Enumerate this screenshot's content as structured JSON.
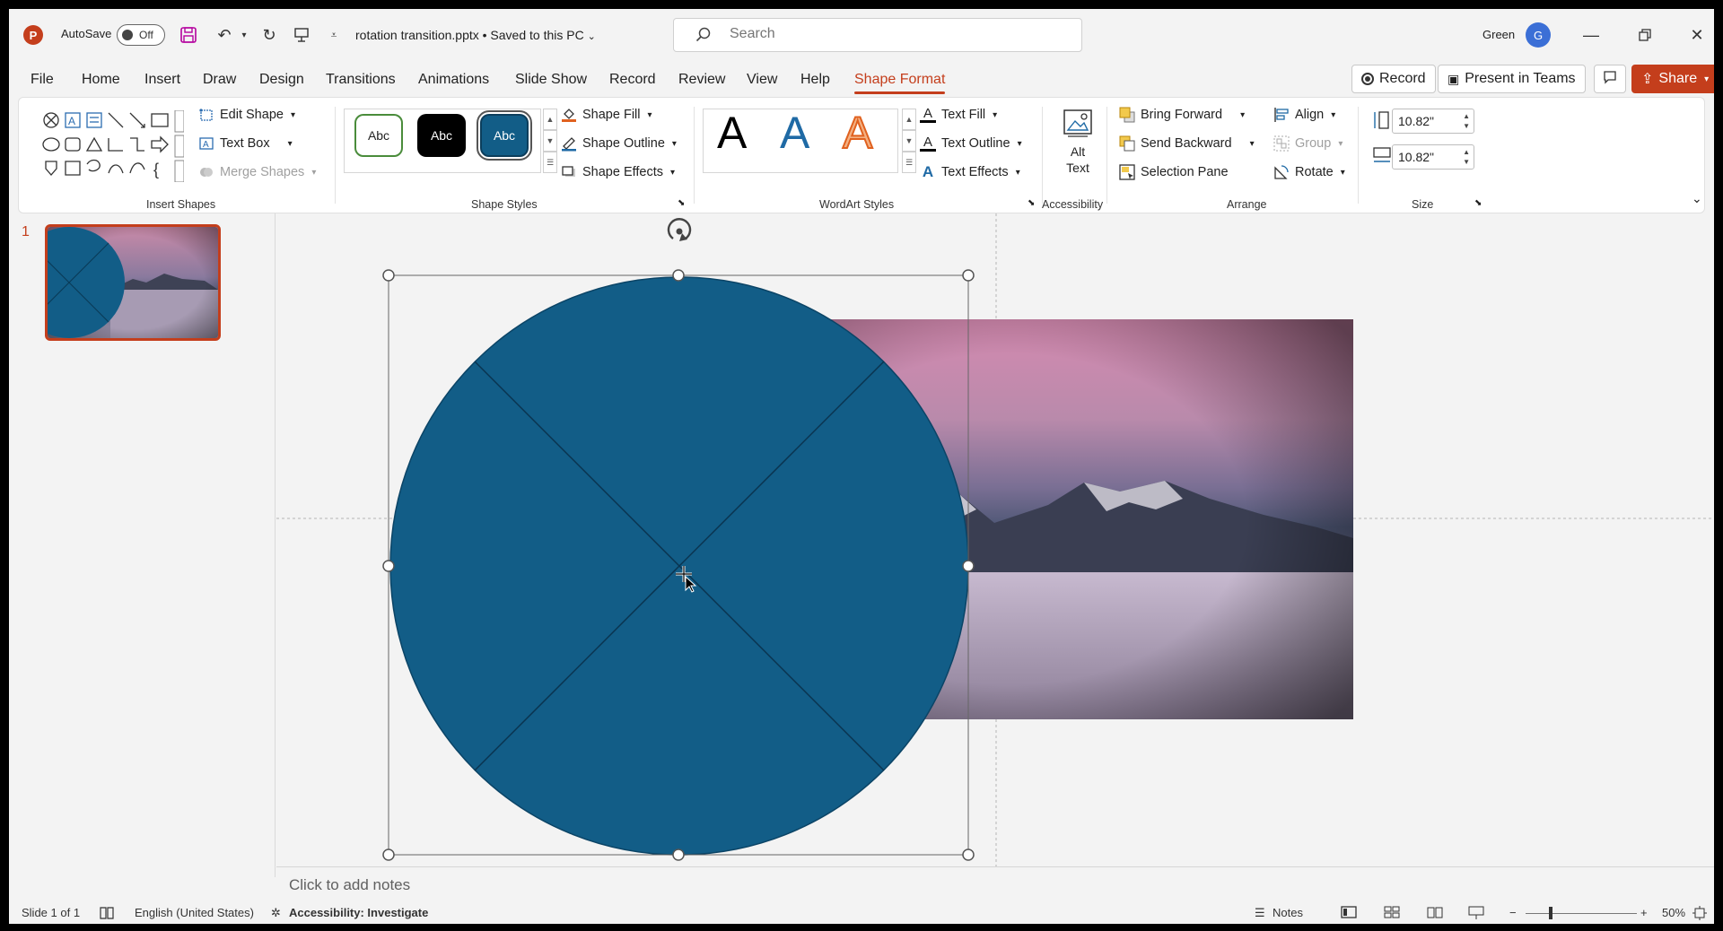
{
  "titlebar": {
    "autosave_label": "AutoSave",
    "autosave_state": "Off",
    "doc_title": "rotation transition.pptx • Saved to this PC",
    "search_placeholder": "Search",
    "user_name": "Green",
    "user_initial": "G"
  },
  "tabs": [
    "File",
    "Home",
    "Insert",
    "Draw",
    "Design",
    "Transitions",
    "Animations",
    "Slide Show",
    "Record",
    "Review",
    "View",
    "Help",
    "Shape Format"
  ],
  "active_tab": "Shape Format",
  "top_right": {
    "record": "Record",
    "present": "Present in Teams",
    "share": "Share"
  },
  "ribbon": {
    "insert_shapes": {
      "label": "Insert Shapes",
      "edit_shape": "Edit Shape",
      "text_box": "Text Box",
      "merge_shapes": "Merge Shapes"
    },
    "shape_styles": {
      "label": "Shape Styles",
      "styles": [
        "Abc",
        "Abc",
        "Abc"
      ],
      "shape_fill": "Shape Fill",
      "shape_outline": "Shape Outline",
      "shape_effects": "Shape Effects"
    },
    "wordart": {
      "label": "WordArt Styles",
      "letters": [
        "A",
        "A",
        "A"
      ],
      "text_fill": "Text Fill",
      "text_outline": "Text Outline",
      "text_effects": "Text Effects"
    },
    "accessibility": {
      "label": "Accessibility",
      "alt_text_line1": "Alt",
      "alt_text_line2": "Text"
    },
    "arrange": {
      "label": "Arrange",
      "bring_forward": "Bring Forward",
      "send_backward": "Send Backward",
      "selection_pane": "Selection Pane",
      "align": "Align",
      "group": "Group",
      "rotate": "Rotate"
    },
    "size": {
      "label": "Size",
      "height": "10.82\"",
      "width": "10.82\""
    }
  },
  "slides_pane": {
    "slide_number": "1"
  },
  "notes_placeholder": "Click to add notes",
  "status": {
    "slide_info": "Slide 1 of 1",
    "language": "English (United States)",
    "accessibility": "Accessibility: Investigate",
    "notes": "Notes",
    "zoom": "50%"
  },
  "colors": {
    "accent": "#c43e1c",
    "shape_fill": "#125d87",
    "canvas_bg": "#f3f3f3"
  }
}
